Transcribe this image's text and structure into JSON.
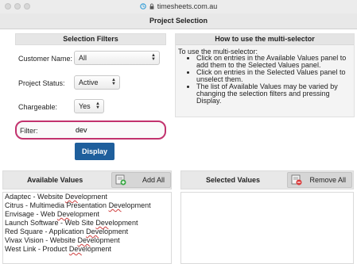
{
  "browser": {
    "url": "timesheets.com.au"
  },
  "page": {
    "title": "Project Selection"
  },
  "filters": {
    "title": "Selection Filters",
    "customer_label": "Customer Name:",
    "customer_value": "All",
    "status_label": "Project Status:",
    "status_value": "Active",
    "chargeable_label": "Chargeable:",
    "chargeable_value": "Yes",
    "filter_label": "Filter:",
    "filter_value": "dev",
    "display_button": "Display"
  },
  "help": {
    "title": "How to use the multi-selector",
    "intro": "To use the multi-selector:",
    "bullets": [
      "Click on entries in the Available Values panel to add them  to the Selected Values panel.",
      "Click on entries in the Selected Values panel to unselect them.",
      "The list of Available Values may be varied by changing the selection filters and pressing Display."
    ]
  },
  "available": {
    "title": "Available Values",
    "add_all": "Add All",
    "items": [
      {
        "before": "Adaptec - Website ",
        "match": "Dev",
        "after": "elopment"
      },
      {
        "before": "Citrus - Multimedia Presentation ",
        "match": "Dev",
        "after": "elopment"
      },
      {
        "before": "Envisage - Web ",
        "match": "Dev",
        "after": "elopment"
      },
      {
        "before": "Launch Software - Web Site ",
        "match": "Dev",
        "after": "elopment"
      },
      {
        "before": "Red Square - Application ",
        "match": "Dev",
        "after": "elopment"
      },
      {
        "before": "Vivax Vision - Website ",
        "match": "Dev",
        "after": "elopment"
      },
      {
        "before": "West Link - Product ",
        "match": "Dev",
        "after": "elopment"
      }
    ]
  },
  "selected": {
    "title": "Selected Values",
    "remove_all": "Remove All",
    "items": []
  },
  "colors": {
    "accent": "#1f5f9c",
    "filter_highlight": "#c2336e"
  }
}
